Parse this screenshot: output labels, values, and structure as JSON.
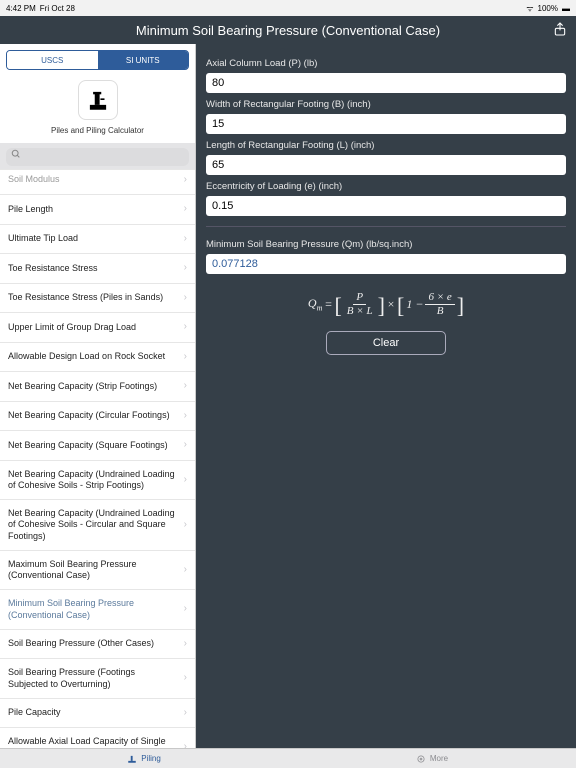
{
  "statusbar": {
    "time": "4:42 PM",
    "date": "Fri Oct 28",
    "signal": "•••",
    "battery": "100%"
  },
  "navbar": {
    "title": "Minimum Soil Bearing Pressure (Conventional Case)"
  },
  "units": {
    "left": "USCS",
    "right": "SI UNITS"
  },
  "app": {
    "label": "Piles and Piling Calculator"
  },
  "search": {
    "placeholder": ""
  },
  "list": {
    "items": [
      "Soil Modulus",
      "Pile Length",
      "Ultimate Tip Load",
      "Toe Resistance Stress",
      "Toe Resistance Stress (Piles in Sands)",
      "Upper Limit of Group Drag Load",
      "Allowable Design Load on Rock Socket",
      "Net Bearing Capacity (Strip Footings)",
      "Net Bearing Capacity (Circular Footings)",
      "Net Bearing Capacity (Square Footings)",
      "Net Bearing Capacity (Undrained Loading of Cohesive Soils - Strip Footings)",
      "Net Bearing Capacity (Undrained Loading of Cohesive Soils - Circular and Square Footings)",
      "Maximum Soil Bearing Pressure (Conventional Case)",
      "Minimum Soil Bearing Pressure (Conventional Case)",
      "Soil Bearing Pressure (Other Cases)",
      "Soil Bearing Pressure (Footings Subjected to Overturning)",
      "Pile Capacity",
      "Allowable Axial Load Capacity of Single Piles"
    ],
    "selectedIndex": 13
  },
  "fields": {
    "p_label": "Axial Column Load (P) (lb)",
    "p_value": "80",
    "b_label": "Width of Rectangular Footing (B) (inch)",
    "b_value": "15",
    "l_label": "Length of Rectangular Footing (L) (inch)",
    "l_value": "65",
    "e_label": "Eccentricity of Loading (e) (inch)",
    "e_value": "0.15",
    "qm_label": "Minimum Soil Bearing Pressure (Qm) (lb/sq.inch)",
    "qm_value": "0.077128"
  },
  "formula": {
    "qm": "Q",
    "qm_sub": "m",
    "eq": " = ",
    "p": "P",
    "bxl": "B × L",
    "times": " × ",
    "one_minus": "1 − ",
    "six_e": "6 × e",
    "b": "B"
  },
  "buttons": {
    "clear": "Clear"
  },
  "tabs": {
    "piling": "Piling",
    "more": "More"
  }
}
